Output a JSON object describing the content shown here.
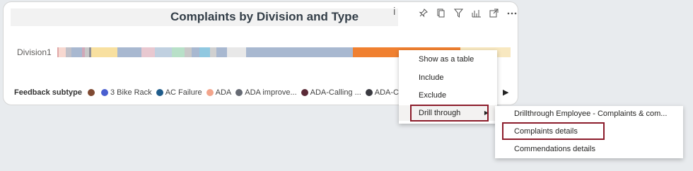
{
  "visual": {
    "title": "Complaints by Division and Type",
    "info_label": "i",
    "y_category": "Division1",
    "toolbar_icons": [
      "pin-icon",
      "copy-icon",
      "filter-icon",
      "analytics-icon",
      "focus-mode-icon",
      "more-options-icon"
    ],
    "legend_title": "Feedback subtype",
    "legend": [
      {
        "label": "",
        "color": "#7f4a32"
      },
      {
        "label": "3 Bike Rack",
        "color": "#4a5fd0"
      },
      {
        "label": "AC Failure",
        "color": "#1f5c8b"
      },
      {
        "label": "ADA",
        "color": "#f3a58c"
      },
      {
        "label": "ADA improve...",
        "color": "#666a73"
      },
      {
        "label": "ADA-Calling ...",
        "color": "#5b2a37"
      },
      {
        "label": "ADA-Cus",
        "color": "#3a3a40"
      }
    ]
  },
  "chart_data": {
    "type": "bar",
    "orientation": "horizontal-stacked-100",
    "categories": [
      "Division1"
    ],
    "series_colors": [
      "#e0a8a8",
      "#f7d8d0",
      "#c0c0c8",
      "#a8b8d0",
      "#d0a8b8",
      "#c8c8c8",
      "#909098",
      "#f8e0a0",
      "#f8e0a0",
      "#a8b8d0",
      "#a8b8d0",
      "#e8c8d0",
      "#c0d0e0",
      "#b8e0c8",
      "#c8c8c8",
      "#a8b8d0",
      "#90c8e0",
      "#d0d0d0",
      "#a8b8d0",
      "#e8e8e8",
      "#a8b8d0",
      "#f08030",
      "#f8e8c0"
    ],
    "segment_shares": [
      0.3,
      1.6,
      1.3,
      2.3,
      0.6,
      1.0,
      0.5,
      3.0,
      2.8,
      3.8,
      1.6,
      3.0,
      3.8,
      2.8,
      1.6,
      1.6,
      2.4,
      1.4,
      2.4,
      4.3,
      23.8,
      23.9,
      11.2
    ]
  },
  "context_menu": {
    "items": [
      "Show as a table",
      "Include",
      "Exclude",
      "Drill through"
    ],
    "submenu": [
      "Drillthrough Employee - Complaints & com...",
      "Complaints details",
      "Commendations details"
    ]
  },
  "colors": {
    "highlight": "#8c1c2b",
    "accent_orange": "#f08030"
  }
}
